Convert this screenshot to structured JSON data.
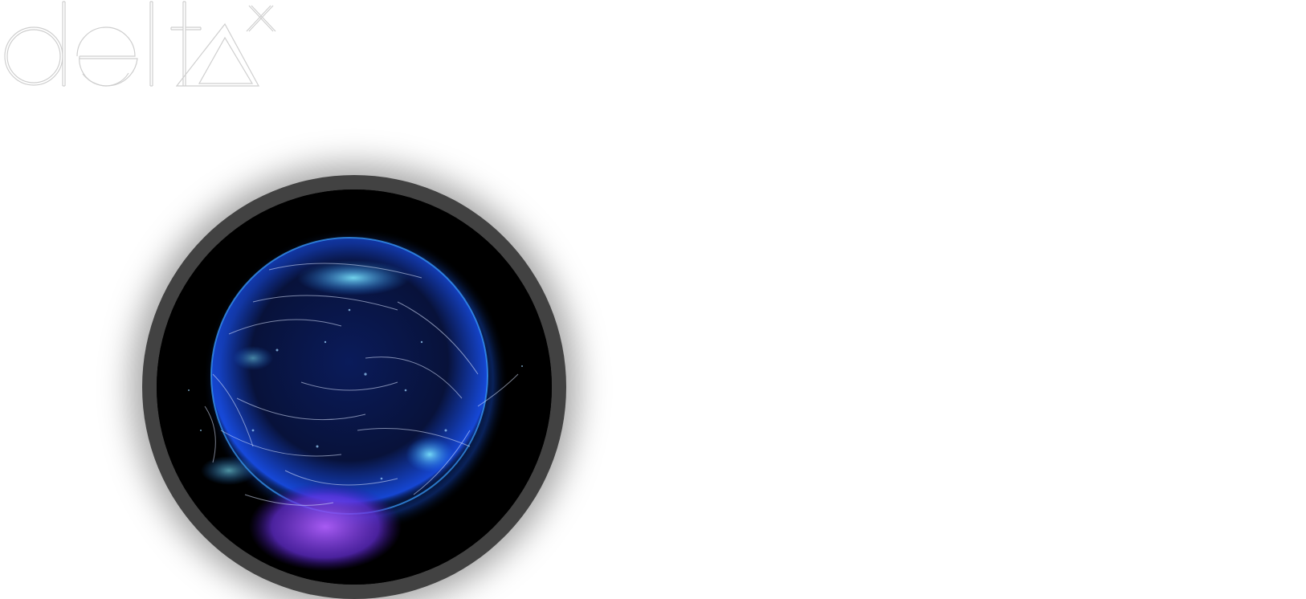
{
  "brand": {
    "name": "delta",
    "superscript": "x"
  },
  "colors": {
    "background": "#ffffff",
    "logo_stroke": "#cfcfcf",
    "orb_frame": "#424242",
    "orb_background": "#000000",
    "globe_blue": "#1e5fff",
    "globe_cyan": "#4fd8ff",
    "globe_purple": "#8a4dff"
  },
  "media": {
    "icon": "particle-globe-icon"
  }
}
